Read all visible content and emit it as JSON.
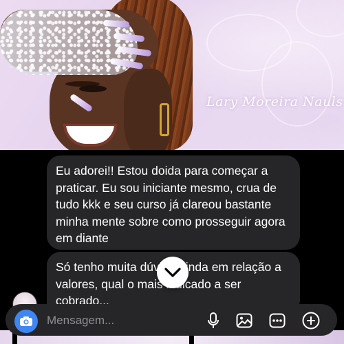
{
  "banner": {
    "watermark": "Lary Moreira Nauls"
  },
  "messages": [
    {
      "text": "Eu adorei!! Estou doida para começar a praticar. Eu sou iniciante mesmo, crua de tudo kkk e seu curso já clareou bastante minha mente sobre como prosseguir agora em diante"
    },
    {
      "text": "Só tenho muita dúvida ainda em relação a valores, qual o mais indicado a ser cobrado..."
    }
  ],
  "composer": {
    "placeholder": "Mensagem..."
  },
  "icons": {
    "camera": "camera-icon",
    "mic": "microphone-icon",
    "gallery": "gallery-icon",
    "sticker": "sticker-icon",
    "plus": "plus-icon",
    "scroll": "chevron-down-icon"
  },
  "colors": {
    "bubble": "#262628",
    "camera_button": "#3f86f2",
    "background": "#000000"
  }
}
